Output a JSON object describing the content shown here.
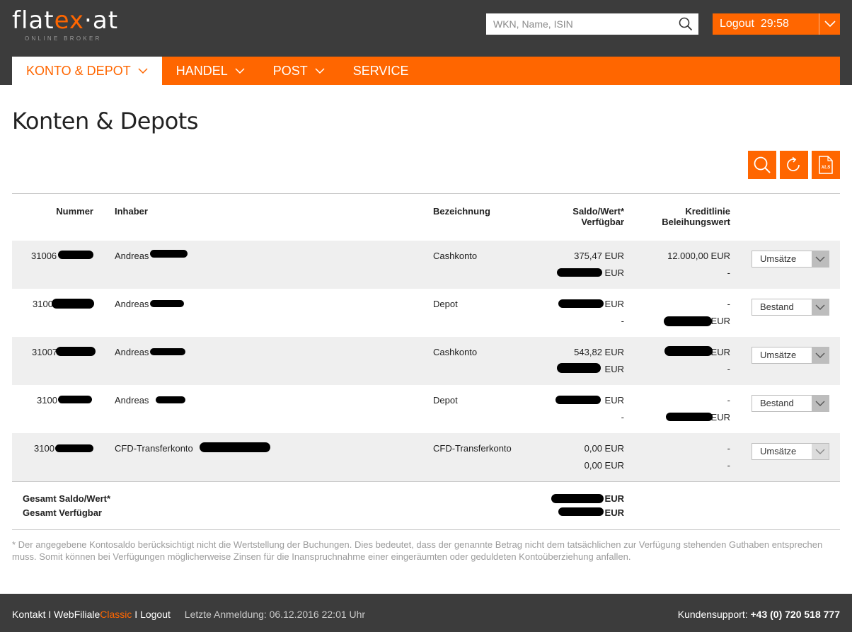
{
  "brand": {
    "logo_main_a": "flat",
    "logo_main_x": "ex",
    "logo_main_b": "·at",
    "logo_sub": "ONLINE BROKER",
    "accent_color": "#ff6600",
    "header_color": "#3c3c3c"
  },
  "search": {
    "placeholder": "WKN, Name, ISIN",
    "value": "",
    "icon": "search-icon"
  },
  "logout": {
    "label": "Logout",
    "timer": "29:58"
  },
  "nav": [
    {
      "label": "KONTO & DEPOT",
      "active": true,
      "has_dropdown": true
    },
    {
      "label": "HANDEL",
      "active": false,
      "has_dropdown": true
    },
    {
      "label": "POST",
      "active": false,
      "has_dropdown": true
    },
    {
      "label": "SERVICE",
      "active": false,
      "has_dropdown": false
    }
  ],
  "page": {
    "title": "Konten & Depots"
  },
  "tools": [
    {
      "icon": "search-icon"
    },
    {
      "icon": "refresh-icon"
    },
    {
      "icon": "xls-export-icon",
      "label": "XLS"
    }
  ],
  "table": {
    "headers": {
      "nummer": "Nummer",
      "inhaber": "Inhaber",
      "bezeichnung": "Bezeichnung",
      "saldo_1": "Saldo/Wert*",
      "saldo_2": "Verfügbar",
      "kredit_1": "Kreditlinie",
      "kredit_2": "Beleihungswert"
    },
    "rows": [
      {
        "nummer": "31006",
        "inhaber": "Andreas",
        "bezeichnung": "Cashkonto",
        "saldo": "375,47 EUR",
        "verfuegbar": "EUR",
        "kreditlinie": "12.000,00 EUR",
        "beleihungswert": "-",
        "action": "Umsätze"
      },
      {
        "nummer": "3100",
        "inhaber": "Andreas",
        "bezeichnung": "Depot",
        "saldo": "EUR",
        "verfuegbar": "-",
        "kreditlinie": "-",
        "beleihungswert": "EUR",
        "action": "Bestand"
      },
      {
        "nummer": "31007",
        "inhaber": "Andreas",
        "bezeichnung": "Cashkonto",
        "saldo": "543,82 EUR",
        "verfuegbar": "EUR",
        "kreditlinie": "EUR",
        "beleihungswert": "-",
        "action": "Umsätze"
      },
      {
        "nummer": "3100",
        "inhaber": "Andreas",
        "bezeichnung": "Depot",
        "saldo": "EUR",
        "verfuegbar": "-",
        "kreditlinie": "-",
        "beleihungswert": "EUR",
        "action": "Bestand"
      },
      {
        "nummer": "3100",
        "inhaber": "CFD-Transferkonto",
        "bezeichnung": "CFD-Transferkonto",
        "saldo": "0,00 EUR",
        "verfuegbar": "0,00 EUR",
        "kreditlinie": "-",
        "beleihungswert": "-",
        "action": "Umsätze",
        "action_disabled": true
      }
    ]
  },
  "totals": {
    "label_saldo": "Gesamt Saldo/Wert*",
    "label_verfuegbar": "Gesamt Verfügbar",
    "saldo": "EUR",
    "verfuegbar": "EUR"
  },
  "note": "* Der angegebene Kontosaldo berücksichtigt nicht die Wertstellung der Buchungen. Dies bedeutet, dass der genannte Betrag nicht dem tatsächlichen zur Verfügung stehenden Guthaben entsprechen muss. Somit können bei Verfügungen möglicherweise Zinsen für die Inanspruchnahme einer eingeräumten oder geduldeten Kontoüberziehung anfallen.",
  "footer": {
    "kontakt": "Kontakt",
    "sep": "I",
    "webfiliale": "WebFiliale",
    "classic": "Classic",
    "logout": "Logout",
    "last_login": "Letzte Anmeldung: 06.12.2016 22:01 Uhr",
    "support_label": "Kundensupport:",
    "support_phone": "+43 (0) 720 518 777"
  }
}
